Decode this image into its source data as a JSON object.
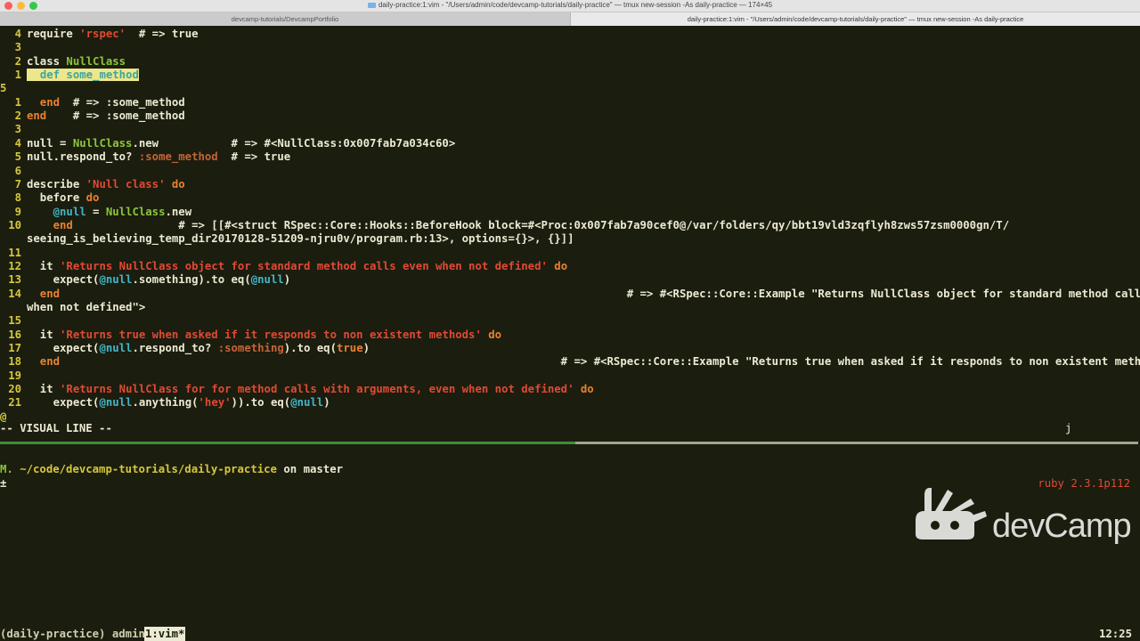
{
  "window": {
    "title": "daily-practice:1:vim - \"/Users/admin/code/devcamp-tutorials/daily-practice\" — tmux new-session -As daily-practice — 174×45",
    "tabs": [
      {
        "label": "devcamp-tutorials/DevcampPortfolio"
      },
      {
        "label": "daily-practice:1:vim - \"/Users/admin/code/devcamp-tutorials/daily-practice\" — tmux new-session -As daily-practice"
      }
    ]
  },
  "editor": {
    "lines": [
      {
        "n": "4",
        "segs": [
          [
            "cmt",
            "require "
          ],
          [
            "str",
            "'rspec'"
          ],
          [
            "cmt",
            "  # => true"
          ]
        ]
      },
      {
        "n": "3",
        "segs": []
      },
      {
        "n": "2",
        "segs": [
          [
            "cmt",
            "class "
          ],
          [
            "cls",
            "NullClass"
          ]
        ]
      },
      {
        "n": "1",
        "segs": [
          [
            "sel",
            "  "
          ],
          [
            "sel-kw",
            "def"
          ],
          [
            "sel",
            " some_method"
          ]
        ]
      },
      {
        "n": "5",
        "segs": [],
        "nleft": true
      },
      {
        "n": "1",
        "segs": [
          [
            "kw",
            "  end"
          ],
          [
            "cmt",
            "  # => :some_method"
          ]
        ]
      },
      {
        "n": "2",
        "segs": [
          [
            "kw",
            "end"
          ],
          [
            "cmt",
            "    # => :some_method"
          ]
        ]
      },
      {
        "n": "3",
        "segs": []
      },
      {
        "n": "4",
        "segs": [
          [
            "cmt",
            "null = "
          ],
          [
            "cls",
            "NullClass"
          ],
          [
            "cmt",
            ".new           # => #<NullClass:0x007fab7a034c60>"
          ]
        ]
      },
      {
        "n": "5",
        "segs": [
          [
            "cmt",
            "null.respond_to? "
          ],
          [
            "sym",
            ":some_method"
          ],
          [
            "cmt",
            "  # => true"
          ]
        ]
      },
      {
        "n": "6",
        "segs": []
      },
      {
        "n": "7",
        "segs": [
          [
            "cmt",
            "describe "
          ],
          [
            "str",
            "'Null class'"
          ],
          [
            "kw",
            " do"
          ]
        ]
      },
      {
        "n": "8",
        "segs": [
          [
            "cmt",
            "  before "
          ],
          [
            "kw",
            "do"
          ]
        ]
      },
      {
        "n": "9",
        "segs": [
          [
            "ivar",
            "    @null"
          ],
          [
            "cmt",
            " = "
          ],
          [
            "cls",
            "NullClass"
          ],
          [
            "cmt",
            ".new"
          ]
        ]
      },
      {
        "n": "10",
        "segs": [
          [
            "kw",
            "    end"
          ],
          [
            "cmt",
            "                # => [[#<struct RSpec::Core::Hooks::BeforeHook block=#<Proc:0x007fab7a90cef0@/var/folders/qy/bbt19vld3zqflyh8zws57zsm0000gn/T/"
          ]
        ]
      },
      {
        "n": "",
        "segs": [
          [
            "cmt",
            "seeing_is_believing_temp_dir20170128-51209-njru0v/program.rb:13>, options={}>, {}]]"
          ]
        ]
      },
      {
        "n": "11",
        "segs": []
      },
      {
        "n": "12",
        "segs": [
          [
            "cmt",
            "  it "
          ],
          [
            "str",
            "'Returns NullClass object for standard method calls even when not defined'"
          ],
          [
            "kw",
            " do"
          ]
        ]
      },
      {
        "n": "13",
        "segs": [
          [
            "cmt",
            "    expect("
          ],
          [
            "ivar",
            "@null"
          ],
          [
            "cmt",
            ".something).to eq("
          ],
          [
            "ivar",
            "@null"
          ],
          [
            "cmt",
            ")"
          ]
        ]
      },
      {
        "n": "14",
        "segs": [
          [
            "kw",
            "  end"
          ],
          [
            "cmt",
            "                                                                                      # => #<RSpec::Core::Example \"Returns NullClass object for standard method calls even"
          ]
        ]
      },
      {
        "n": "",
        "segs": [
          [
            "cmt",
            "when not defined\">"
          ]
        ]
      },
      {
        "n": "15",
        "segs": []
      },
      {
        "n": "16",
        "segs": [
          [
            "cmt",
            "  it "
          ],
          [
            "str",
            "'Returns true when asked if it responds to non existent methods'"
          ],
          [
            "kw",
            " do"
          ]
        ]
      },
      {
        "n": "17",
        "segs": [
          [
            "cmt",
            "    expect("
          ],
          [
            "ivar",
            "@null"
          ],
          [
            "cmt",
            ".respond_to? "
          ],
          [
            "sym",
            ":something"
          ],
          [
            "cmt",
            ").to eq("
          ],
          [
            "kw",
            "true"
          ],
          [
            "cmt",
            ")"
          ]
        ]
      },
      {
        "n": "18",
        "segs": [
          [
            "kw",
            "  end"
          ],
          [
            "cmt",
            "                                                                            # => #<RSpec::Core::Example \"Returns true when asked if it responds to non existent methods\">"
          ]
        ]
      },
      {
        "n": "19",
        "segs": []
      },
      {
        "n": "20",
        "segs": [
          [
            "cmt",
            "  it "
          ],
          [
            "str",
            "'Returns NullClass for for method calls with arguments, even when not defined'"
          ],
          [
            "kw",
            " do"
          ]
        ]
      },
      {
        "n": "21",
        "segs": [
          [
            "cmt",
            "    expect("
          ],
          [
            "ivar",
            "@null"
          ],
          [
            "cmt",
            ".anything("
          ],
          [
            "str",
            "'hey'"
          ],
          [
            "cmt",
            ")).to eq("
          ],
          [
            "ivar",
            "@null"
          ],
          [
            "cmt",
            ")"
          ]
        ]
      },
      {
        "n": "@",
        "segs": [],
        "nleft": true
      }
    ],
    "mode_label": "-- VISUAL LINE --",
    "pending_key": "j"
  },
  "shell": {
    "modified_marker": "M.",
    "path": "~/code/devcamp-tutorials/daily-practice",
    "on": "on",
    "branch": "master",
    "plus": "±",
    "ruby_version": "ruby 2.3.1p112"
  },
  "logo": {
    "text": "devCamp",
    "icon": "swiss-army-knife-logo-icon"
  },
  "tmux": {
    "session": "(daily-practice) admin",
    "window": "1:vim*",
    "time": "12:25"
  },
  "colors": {
    "background": "#1b1d0f",
    "line_number": "#d5c73b",
    "keyword": "#e88230",
    "class": "#8bc639",
    "string": "#e04a33",
    "ivar": "#43b5c7",
    "divider_active": "#3f8f36"
  }
}
